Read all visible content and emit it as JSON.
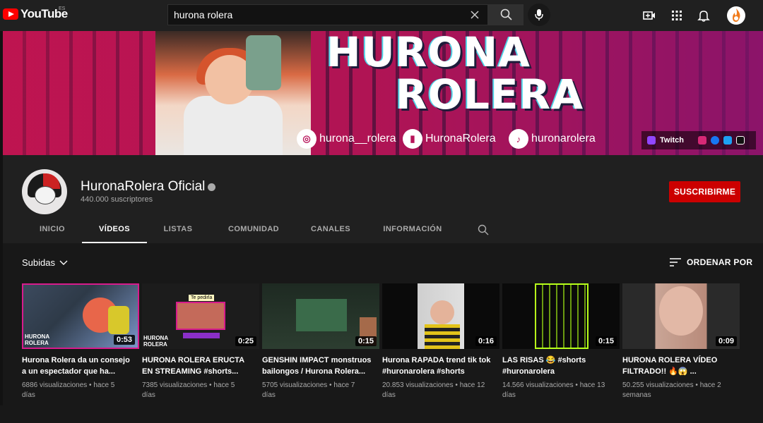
{
  "header": {
    "logo_text": "YouTube",
    "logo_region": "ES",
    "search_value": "hurona rolera"
  },
  "banner": {
    "title_line1": "HURONA",
    "title_line2": "ROLERA",
    "instagram": "hurona__rolera",
    "twitch": "HuronaRolera",
    "tiktok": "huronarolera",
    "link_twitch": "Twitch"
  },
  "channel": {
    "name": "HuronaRolera Oficial",
    "subscribers": "440.000 suscriptores",
    "subscribe_label": "SUSCRIBIRME",
    "tabs": [
      "INICIO",
      "VÍDEOS",
      "LISTAS",
      "COMUNIDAD",
      "CANALES",
      "INFORMACIÓN"
    ],
    "active_tab": "VÍDEOS"
  },
  "content": {
    "filter_label": "Subidas",
    "sort_label": "ORDENAR POR",
    "videos": [
      {
        "title": "Hurona Rolera da un consejo a un espectador que ha...",
        "views": "6886 visualizaciones",
        "age": "hace 5 días",
        "duration": "0:53",
        "watermark": "HURONA ROLERA"
      },
      {
        "title": "HURONA ROLERA ERUCTA EN STREAMING #shorts...",
        "views": "7385 visualizaciones",
        "age": "hace 5 días",
        "duration": "0:25",
        "watermark": "HURONA ROLERA",
        "caption": "Te pedirla"
      },
      {
        "title": "GENSHIN IMPACT monstruos bailongos / Hurona Rolera...",
        "views": "5705 visualizaciones",
        "age": "hace 7 días",
        "duration": "0:15"
      },
      {
        "title": "Hurona RAPADA trend tik tok #huronarolera #shorts",
        "views": "20.853 visualizaciones",
        "age": "hace 12 días",
        "duration": "0:16"
      },
      {
        "title": "LAS RISAS 😂 #shorts #huronarolera",
        "views": "14.566 visualizaciones",
        "age": "hace 13 días",
        "duration": "0:15"
      },
      {
        "title": "HURONA ROLERA VÍDEO FILTRADO!! 🔥😱 ...",
        "views": "50.255 visualizaciones",
        "age": "hace 2 semanas",
        "duration": "0:09"
      }
    ]
  },
  "colors": {
    "subscribe": "#cc0000",
    "background": "#181818",
    "header": "#202020"
  }
}
